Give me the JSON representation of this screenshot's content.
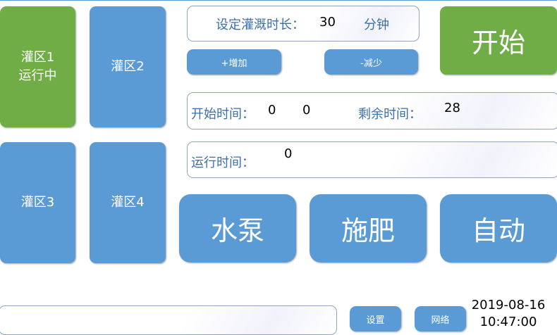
{
  "zones": {
    "zone1": {
      "name": "灌区1",
      "status": "运行中"
    },
    "zone2": {
      "name": "灌区2"
    },
    "zone3": {
      "name": "灌区3"
    },
    "zone4": {
      "name": "灌区4"
    }
  },
  "duration": {
    "label": "设定灌溉时长：",
    "value": "30",
    "unit": "分钟",
    "increase_label": "+增加",
    "decrease_label": "-减少"
  },
  "start_button_label": "开始",
  "times": {
    "start_label": "开始时间：",
    "start_hour": "0",
    "start_minute": "0",
    "remaining_label": "剩余时间：",
    "remaining_value": "28",
    "run_label": "运行时间：",
    "run_value": "0"
  },
  "controls": {
    "pump_label": "水泵",
    "fertilize_label": "施肥",
    "auto_label": "自动"
  },
  "footer": {
    "settings_label": "设置",
    "network_label": "网络",
    "date": "2019-08-16",
    "time": "10:47:00"
  },
  "colors": {
    "button_blue": "#5b9bd5",
    "active_green": "#70ad47",
    "label_blue": "#3e6fa8"
  }
}
